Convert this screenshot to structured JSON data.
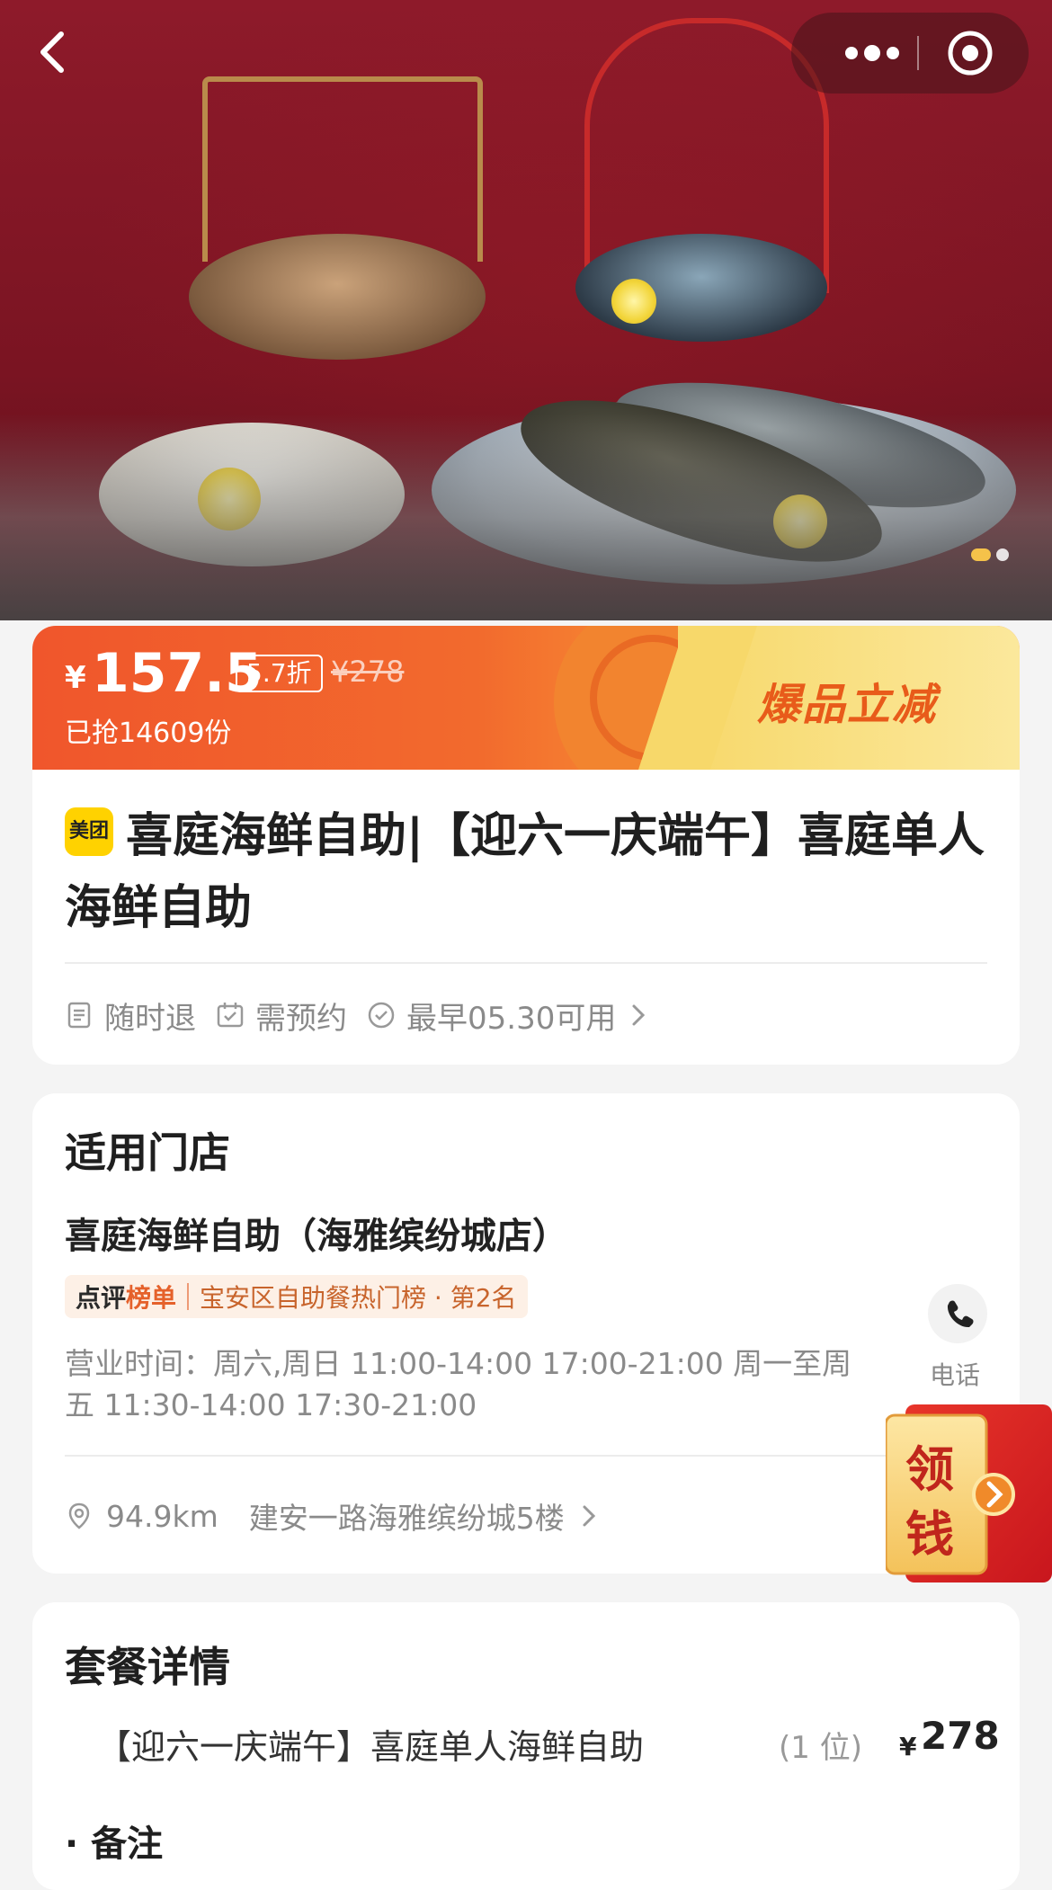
{
  "nav": {
    "back_icon": "chevron-left-icon",
    "more_icon": "more-dots-icon",
    "close_icon": "target-circle-icon"
  },
  "hero": {
    "image_subject": "seafood-buffet-photo",
    "pager_count": 2,
    "pager_active": 0
  },
  "promo": {
    "currency": "¥",
    "price": "157.5",
    "discount": "5.7折",
    "original_price": "¥278",
    "sold": "已抢14609份",
    "tag": "爆品立减",
    "colors": {
      "primary": "#f0562c",
      "tag": "#e85b1a"
    }
  },
  "deal": {
    "badge": "美团",
    "title": "喜庭海鲜自助|【迎六一庆端午】喜庭单人海鲜自助",
    "features": [
      {
        "icon": "refund-doc-icon",
        "label": "随时退"
      },
      {
        "icon": "calendar-check-icon",
        "label": "需预约"
      },
      {
        "icon": "check-circle-icon",
        "label": "最早05.30可用"
      }
    ],
    "features_chevron": "chevron-right-icon"
  },
  "store": {
    "section_title": "适用门店",
    "name": "喜庭海鲜自助（海雅缤纷城店）",
    "rank_logo_a": "点评",
    "rank_logo_b": "榜单",
    "rank_text": "宝安区自助餐热门榜 · 第2名",
    "hours": "营业时间：周六,周日 11:00-14:00 17:00-21:00 周一至周五 11:30-14:00 17:30-21:00",
    "phone_label": "电话",
    "distance": "94.9km",
    "address": "建安一路海雅缤纷城5楼"
  },
  "package": {
    "section_title": "套餐详情",
    "item_name": "【迎六一庆端午】喜庭单人海鲜自助",
    "item_qty": "(1 位)",
    "item_currency": "¥",
    "item_price": "278",
    "note_label": "· 备注"
  },
  "coupon": {
    "label_line1": "领",
    "label_line2": "钱"
  }
}
